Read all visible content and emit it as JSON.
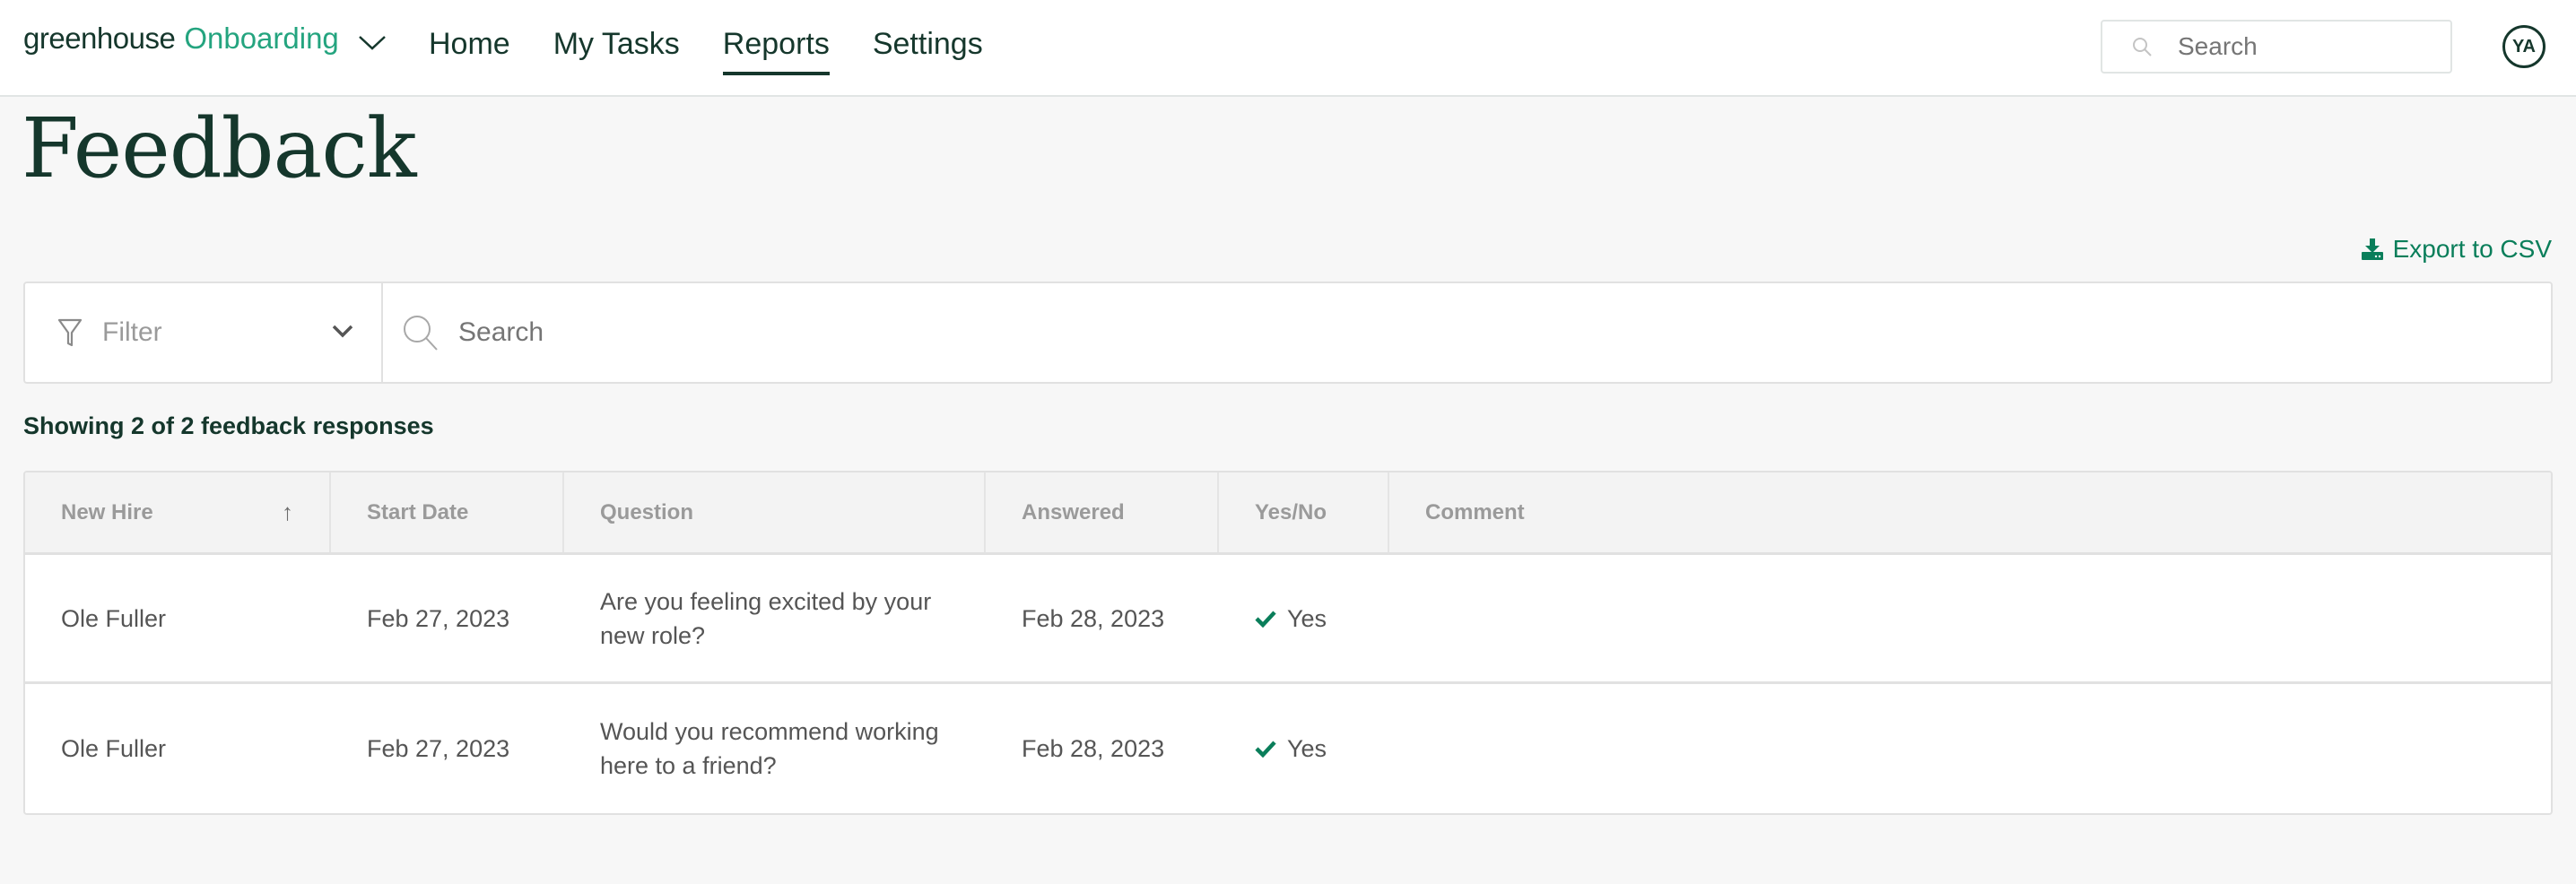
{
  "header": {
    "brand": "greenhouse",
    "product": "Onboarding",
    "nav": [
      {
        "label": "Home",
        "active": false
      },
      {
        "label": "My Tasks",
        "active": false
      },
      {
        "label": "Reports",
        "active": true
      },
      {
        "label": "Settings",
        "active": false
      }
    ],
    "search_placeholder": "Search",
    "avatar_initials": "YA"
  },
  "page": {
    "title": "Feedback",
    "export_label": "Export to CSV",
    "filter_label": "Filter",
    "search_placeholder": "Search",
    "count_text": "Showing 2 of 2 feedback responses"
  },
  "table": {
    "columns": [
      "New Hire",
      "Start Date",
      "Question",
      "Answered",
      "Yes/No",
      "Comment"
    ],
    "sort_indicator": "↑",
    "rows": [
      {
        "new_hire": "Ole Fuller",
        "start_date": "Feb 27, 2023",
        "question": "Are you feeling excited by your new role?",
        "answered": "Feb 28, 2023",
        "yes_no": "Yes",
        "comment": ""
      },
      {
        "new_hire": "Ole Fuller",
        "start_date": "Feb 27, 2023",
        "question": "Would you recommend working here to a friend?",
        "answered": "Feb 28, 2023",
        "yes_no": "Yes",
        "comment": ""
      }
    ]
  },
  "colors": {
    "brand_dark": "#15372c",
    "brand_green": "#24a47f",
    "accent_green": "#0a7e5a"
  }
}
